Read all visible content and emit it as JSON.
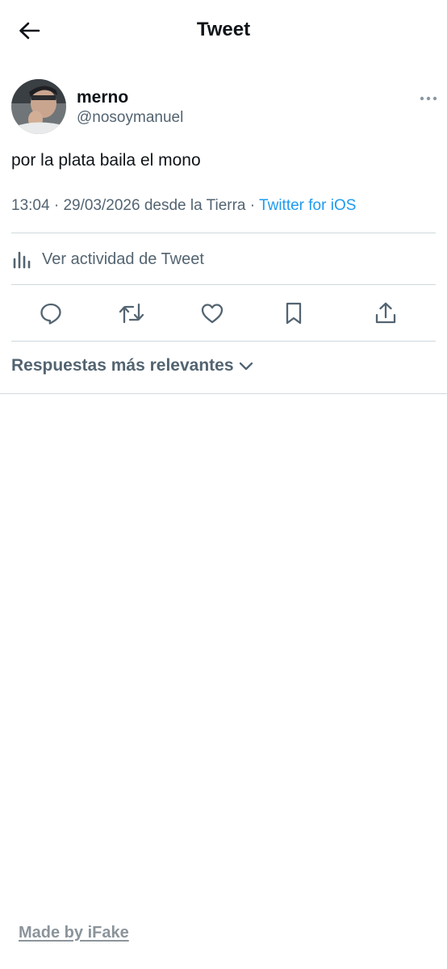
{
  "header": {
    "title": "Tweet",
    "back_icon": "arrow-left-icon"
  },
  "tweet": {
    "author": {
      "name": "merno",
      "handle": "@nosoymanuel"
    },
    "text": "por la plata baila el mono",
    "time": "13:04",
    "date": "29/03/2026",
    "location": "desde la Tierra",
    "source": "Twitter for iOS",
    "separator": "·"
  },
  "activity": {
    "label": "Ver actividad de Tweet",
    "icon": "bar-chart-icon"
  },
  "actions": [
    {
      "name": "reply",
      "icon": "reply-icon"
    },
    {
      "name": "retweet",
      "icon": "retweet-icon"
    },
    {
      "name": "like",
      "icon": "heart-icon"
    },
    {
      "name": "bookmark",
      "icon": "bookmark-icon"
    },
    {
      "name": "share",
      "icon": "share-icon"
    }
  ],
  "replies": {
    "sort_label": "Respuestas más relevantes"
  },
  "watermark": {
    "label": "Made by iFake"
  },
  "colors": {
    "link": "#1d9bf0",
    "secondary_text": "#536471",
    "divider": "#cfd9de",
    "primary_text": "#0f1419"
  }
}
